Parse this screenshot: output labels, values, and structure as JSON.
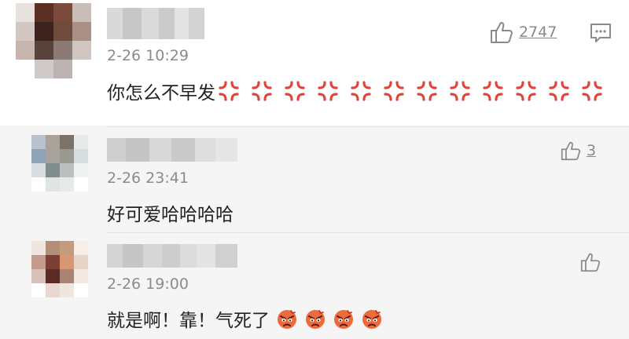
{
  "comments": [
    {
      "time": "2-26 10:29",
      "text": "你怎么不早发",
      "likes": "2747",
      "emoji": "angry-anger-symbol-icon",
      "emoji_count": 12
    },
    {
      "time": "2-26 23:41",
      "text": "好可爱哈哈哈哈",
      "likes": "3"
    },
    {
      "time": "2-26 19:00",
      "text": "就是啊！靠！气死了",
      "likes": "",
      "emoji": "angry-face-icon",
      "emoji_count": 4
    }
  ],
  "colors": {
    "anger_red": "#e0453a",
    "angry_face_orange": "#ec6a3c",
    "meta_grey": "#8b8b8b"
  },
  "icons": {
    "like": "thumbs-up-icon",
    "reply": "comment-icon"
  }
}
